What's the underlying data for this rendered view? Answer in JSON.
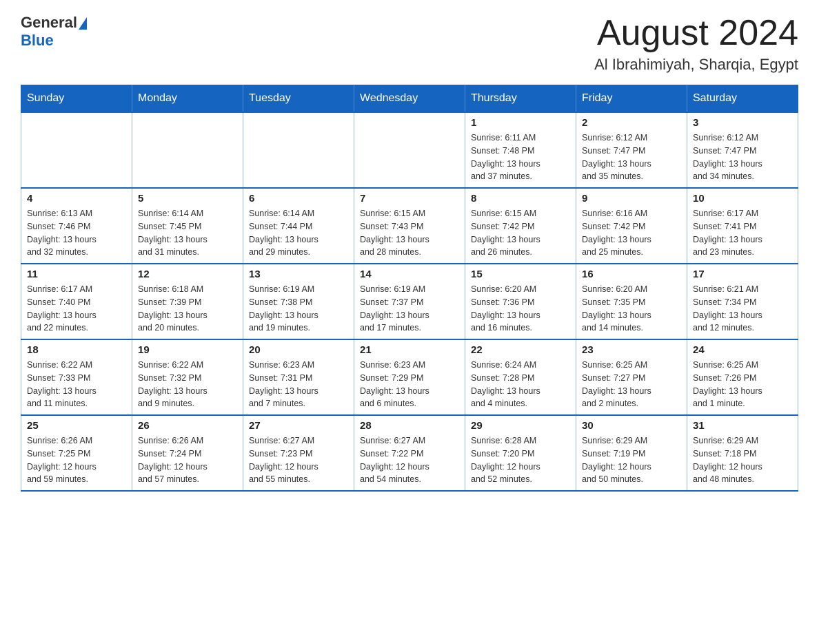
{
  "header": {
    "logo_general": "General",
    "logo_blue": "Blue",
    "month_title": "August 2024",
    "location": "Al Ibrahimiyah, Sharqia, Egypt"
  },
  "weekdays": [
    "Sunday",
    "Monday",
    "Tuesday",
    "Wednesday",
    "Thursday",
    "Friday",
    "Saturday"
  ],
  "weeks": [
    [
      {
        "day": "",
        "info": ""
      },
      {
        "day": "",
        "info": ""
      },
      {
        "day": "",
        "info": ""
      },
      {
        "day": "",
        "info": ""
      },
      {
        "day": "1",
        "info": "Sunrise: 6:11 AM\nSunset: 7:48 PM\nDaylight: 13 hours\nand 37 minutes."
      },
      {
        "day": "2",
        "info": "Sunrise: 6:12 AM\nSunset: 7:47 PM\nDaylight: 13 hours\nand 35 minutes."
      },
      {
        "day": "3",
        "info": "Sunrise: 6:12 AM\nSunset: 7:47 PM\nDaylight: 13 hours\nand 34 minutes."
      }
    ],
    [
      {
        "day": "4",
        "info": "Sunrise: 6:13 AM\nSunset: 7:46 PM\nDaylight: 13 hours\nand 32 minutes."
      },
      {
        "day": "5",
        "info": "Sunrise: 6:14 AM\nSunset: 7:45 PM\nDaylight: 13 hours\nand 31 minutes."
      },
      {
        "day": "6",
        "info": "Sunrise: 6:14 AM\nSunset: 7:44 PM\nDaylight: 13 hours\nand 29 minutes."
      },
      {
        "day": "7",
        "info": "Sunrise: 6:15 AM\nSunset: 7:43 PM\nDaylight: 13 hours\nand 28 minutes."
      },
      {
        "day": "8",
        "info": "Sunrise: 6:15 AM\nSunset: 7:42 PM\nDaylight: 13 hours\nand 26 minutes."
      },
      {
        "day": "9",
        "info": "Sunrise: 6:16 AM\nSunset: 7:42 PM\nDaylight: 13 hours\nand 25 minutes."
      },
      {
        "day": "10",
        "info": "Sunrise: 6:17 AM\nSunset: 7:41 PM\nDaylight: 13 hours\nand 23 minutes."
      }
    ],
    [
      {
        "day": "11",
        "info": "Sunrise: 6:17 AM\nSunset: 7:40 PM\nDaylight: 13 hours\nand 22 minutes."
      },
      {
        "day": "12",
        "info": "Sunrise: 6:18 AM\nSunset: 7:39 PM\nDaylight: 13 hours\nand 20 minutes."
      },
      {
        "day": "13",
        "info": "Sunrise: 6:19 AM\nSunset: 7:38 PM\nDaylight: 13 hours\nand 19 minutes."
      },
      {
        "day": "14",
        "info": "Sunrise: 6:19 AM\nSunset: 7:37 PM\nDaylight: 13 hours\nand 17 minutes."
      },
      {
        "day": "15",
        "info": "Sunrise: 6:20 AM\nSunset: 7:36 PM\nDaylight: 13 hours\nand 16 minutes."
      },
      {
        "day": "16",
        "info": "Sunrise: 6:20 AM\nSunset: 7:35 PM\nDaylight: 13 hours\nand 14 minutes."
      },
      {
        "day": "17",
        "info": "Sunrise: 6:21 AM\nSunset: 7:34 PM\nDaylight: 13 hours\nand 12 minutes."
      }
    ],
    [
      {
        "day": "18",
        "info": "Sunrise: 6:22 AM\nSunset: 7:33 PM\nDaylight: 13 hours\nand 11 minutes."
      },
      {
        "day": "19",
        "info": "Sunrise: 6:22 AM\nSunset: 7:32 PM\nDaylight: 13 hours\nand 9 minutes."
      },
      {
        "day": "20",
        "info": "Sunrise: 6:23 AM\nSunset: 7:31 PM\nDaylight: 13 hours\nand 7 minutes."
      },
      {
        "day": "21",
        "info": "Sunrise: 6:23 AM\nSunset: 7:29 PM\nDaylight: 13 hours\nand 6 minutes."
      },
      {
        "day": "22",
        "info": "Sunrise: 6:24 AM\nSunset: 7:28 PM\nDaylight: 13 hours\nand 4 minutes."
      },
      {
        "day": "23",
        "info": "Sunrise: 6:25 AM\nSunset: 7:27 PM\nDaylight: 13 hours\nand 2 minutes."
      },
      {
        "day": "24",
        "info": "Sunrise: 6:25 AM\nSunset: 7:26 PM\nDaylight: 13 hours\nand 1 minute."
      }
    ],
    [
      {
        "day": "25",
        "info": "Sunrise: 6:26 AM\nSunset: 7:25 PM\nDaylight: 12 hours\nand 59 minutes."
      },
      {
        "day": "26",
        "info": "Sunrise: 6:26 AM\nSunset: 7:24 PM\nDaylight: 12 hours\nand 57 minutes."
      },
      {
        "day": "27",
        "info": "Sunrise: 6:27 AM\nSunset: 7:23 PM\nDaylight: 12 hours\nand 55 minutes."
      },
      {
        "day": "28",
        "info": "Sunrise: 6:27 AM\nSunset: 7:22 PM\nDaylight: 12 hours\nand 54 minutes."
      },
      {
        "day": "29",
        "info": "Sunrise: 6:28 AM\nSunset: 7:20 PM\nDaylight: 12 hours\nand 52 minutes."
      },
      {
        "day": "30",
        "info": "Sunrise: 6:29 AM\nSunset: 7:19 PM\nDaylight: 12 hours\nand 50 minutes."
      },
      {
        "day": "31",
        "info": "Sunrise: 6:29 AM\nSunset: 7:18 PM\nDaylight: 12 hours\nand 48 minutes."
      }
    ]
  ]
}
